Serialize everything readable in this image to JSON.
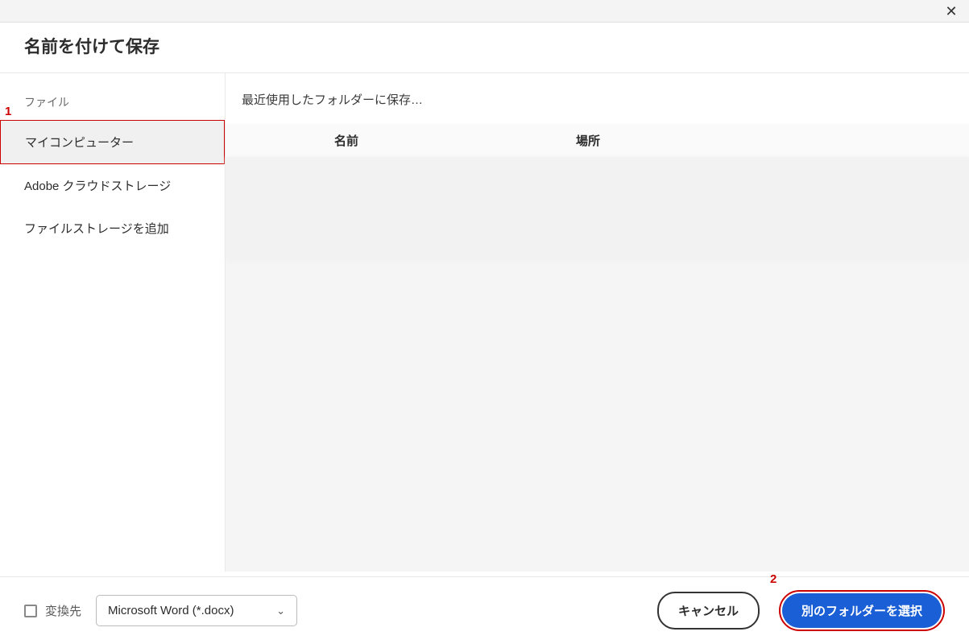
{
  "dialog": {
    "title": "名前を付けて保存"
  },
  "sidebar": {
    "section_label": "ファイル",
    "items": [
      {
        "label": "マイコンピューター",
        "selected": true
      },
      {
        "label": "Adobe クラウドストレージ",
        "selected": false
      },
      {
        "label": "ファイルストレージを追加",
        "selected": false
      }
    ]
  },
  "main": {
    "heading": "最近使用したフォルダーに保存…",
    "columns": {
      "name": "名前",
      "location": "場所"
    }
  },
  "footer": {
    "convert_label": "変換先",
    "format_selected": "Microsoft Word (*.docx)",
    "cancel": "キャンセル",
    "choose_other": "別のフォルダーを選択"
  },
  "annotations": {
    "one": "1",
    "two": "2"
  }
}
